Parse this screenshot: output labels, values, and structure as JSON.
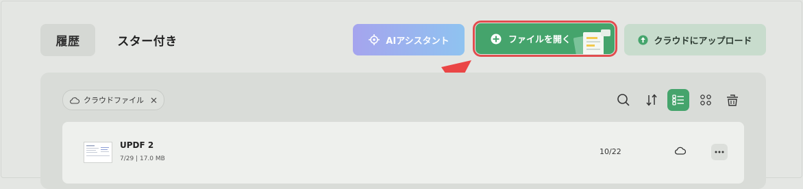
{
  "tabs": {
    "history": "履歴",
    "starred": "スター付き"
  },
  "buttons": {
    "ai_assistant": "AIアシスタント",
    "open_file": "ファイルを開く",
    "upload_cloud": "クラウドにアップロード"
  },
  "filter": {
    "chip_label": "クラウドファイル"
  },
  "toolbar": {
    "icons": [
      "search-icon",
      "sort-icon",
      "list-view-icon",
      "grid-view-icon",
      "trash-icon"
    ]
  },
  "files": [
    {
      "name": "UPDF 2",
      "meta": "7/29 | 17.0 MB",
      "pages": "10/22",
      "cloud": true
    }
  ],
  "colors": {
    "accent_green": "#45a46c",
    "highlight_red": "#e14d4f",
    "background": "#e4e6e3",
    "ai_gradient_start": "#a5a4ee",
    "ai_gradient_end": "#8fc3f0",
    "upload_bg": "#c8dccd"
  }
}
